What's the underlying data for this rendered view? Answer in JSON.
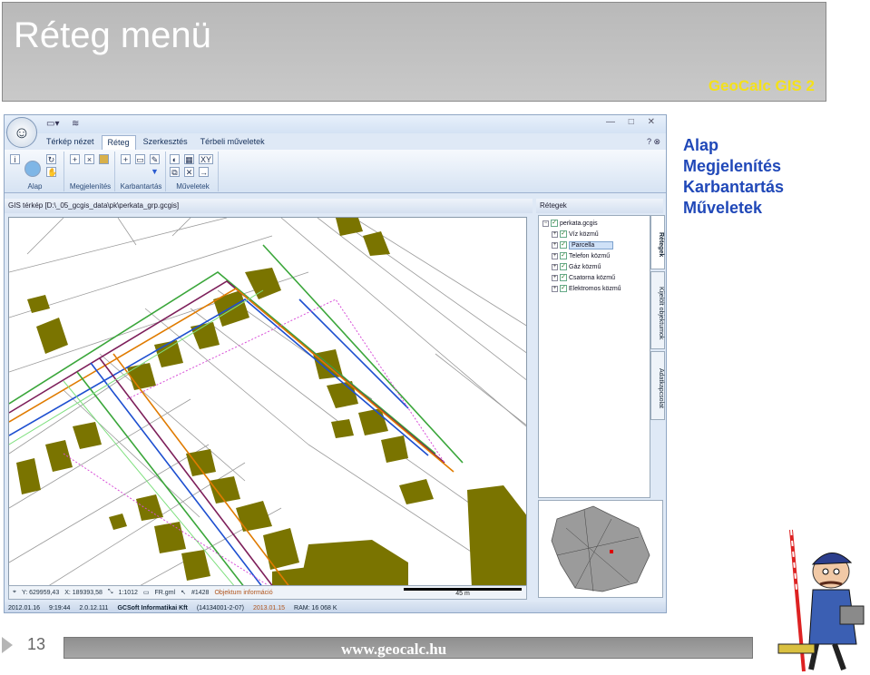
{
  "slide": {
    "title": "Réteg menü",
    "brand": "GeoCalc GIS 2",
    "page_number": "13",
    "website": "www.geocalc.hu",
    "colors": {
      "title_bar": "#c2c2c2",
      "brand": "#f4e11a",
      "menu_text": "#2048b8",
      "footer_bar": "#9a9a9a"
    }
  },
  "menu_items": [
    "Alap",
    "Megjelenítés",
    "Karbantartás",
    "Műveletek"
  ],
  "app": {
    "window_controls": "— □ ✕",
    "help": "? ⊗",
    "tabs": [
      "Térkép nézet",
      "Réteg",
      "Szerkesztés",
      "Térbeli műveletek"
    ],
    "active_tab": "Réteg",
    "ribbon_groups": [
      "Alap",
      "Megjelenítés",
      "Karbantartás",
      "Műveletek"
    ],
    "map_header": "GIS térkép [D:\\_05_gcgis_data\\pk\\perkata_grp.gcgis]",
    "layers_header": "Rétegek",
    "layer_root": "perkata.gcgis",
    "layers": [
      {
        "name": "Víz közmű",
        "selected": false
      },
      {
        "name": "Parcella",
        "selected": true
      },
      {
        "name": "Telefon közmű",
        "selected": false
      },
      {
        "name": "Gáz közmű",
        "selected": false
      },
      {
        "name": "Csatorna közmű",
        "selected": false
      },
      {
        "name": "Elektromos közmű",
        "selected": false
      }
    ],
    "side_tabs": [
      "Rétegek",
      "Kijelölt objektumok",
      "Adatkapcsolat"
    ],
    "coord_y": "Y: 629959,43",
    "coord_x": "X: 189393,58",
    "scale": "1:1012",
    "file": "FR.gml",
    "object_id": "#1428",
    "info": "Objektum információ",
    "scale_bar": "45 m",
    "status": {
      "date": "2012.01.16",
      "time": "9:19:44",
      "version": "2.0.12.111",
      "company": "GCSoft Informatikai Kft",
      "license": "(14134001-2-07)",
      "license_date": "2013.01.15",
      "ram": "RAM: 16 068 K"
    }
  }
}
